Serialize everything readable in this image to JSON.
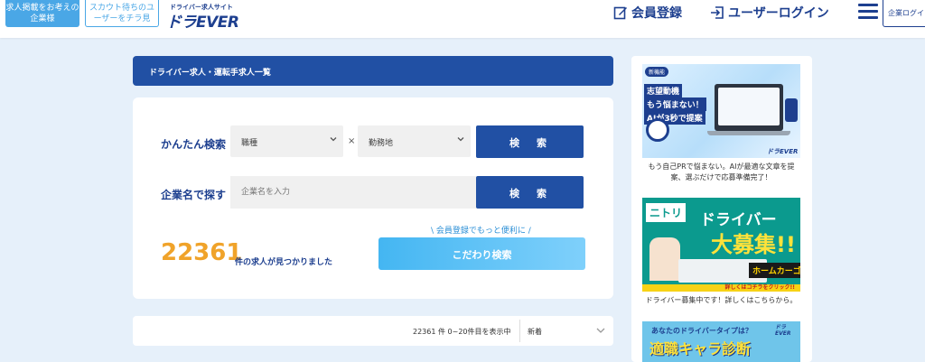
{
  "header": {
    "employer_btn": "求人掲載をお考えの企業様",
    "scout_btn": "スカウト待ちのユーザーをチラ見",
    "logo_sub": "ドライバー求人サイト",
    "logo_main": "ドラEVER",
    "register": "会員登録",
    "login": "ユーザーログイン",
    "company_login": "企業ログイ"
  },
  "main": {
    "title": "ドライバー求人・運転手求人一覧",
    "easy_search_label": "かんたん検索",
    "job_select": "職種",
    "times": "×",
    "location_select": "勤務地",
    "search_btn": "検　索",
    "company_label": "企業名で探す",
    "company_placeholder": "企業名を入力",
    "count": "22361",
    "count_suffix": "件の求人が見つかりました",
    "promo": "\\ 会員登録でもっと便利に /",
    "detail_btn": "こだわり検索",
    "results_text": "22361 件 0~20件目を表示中",
    "sort": "新着"
  },
  "sidebar": {
    "ad1": {
      "tag": "新機能",
      "line1": "志望動機",
      "line2": "もう悩まない！",
      "line3": "AIが3秒で提案",
      "logo": "ドラEVER",
      "caption": "もう自己PRで悩まない。AIが最適な文章を提案、選ぶだけで応募準備完了！"
    },
    "ad2": {
      "nitori": "ニトリ",
      "t1": "ドライバー",
      "t2": "大募集!!",
      "home": "ホームカーゴ",
      "bar": "詳しくはコチラをクリック!!",
      "caption": "ドライバー募集中です！詳しくはこちらから。"
    },
    "ad3": {
      "q": "あなたのドライバータイプは？",
      "big": "適職キャラ診断",
      "logo": "ドラEVER"
    }
  }
}
